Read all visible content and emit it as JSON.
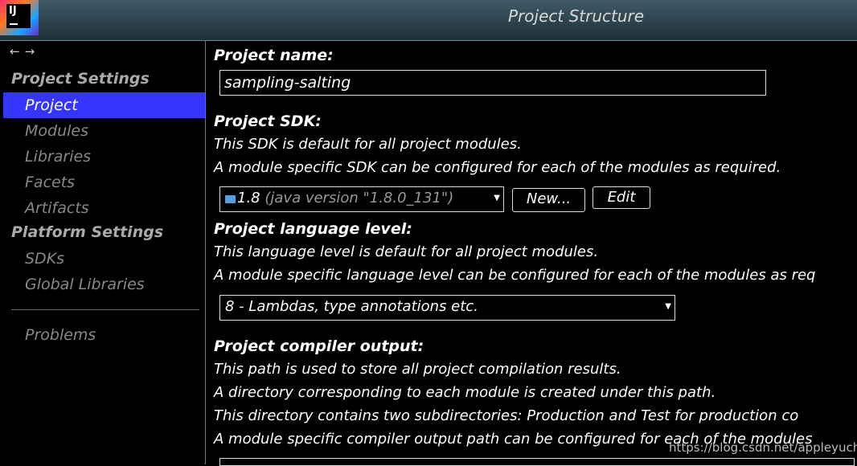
{
  "window": {
    "title": "Project Structure",
    "app_icon_text": "IJ"
  },
  "nav": {
    "back": "←",
    "forward": "→"
  },
  "sidebar": {
    "project_settings_header": "Project Settings",
    "project_settings_items": [
      {
        "label": "Project",
        "selected": true
      },
      {
        "label": "Modules"
      },
      {
        "label": "Libraries"
      },
      {
        "label": "Facets"
      },
      {
        "label": "Artifacts"
      }
    ],
    "platform_settings_header": "Platform Settings",
    "platform_settings_items": [
      {
        "label": "SDKs"
      },
      {
        "label": "Global Libraries"
      }
    ],
    "problems_label": "Problems"
  },
  "project_name": {
    "label": "Project name:",
    "value": "sampling-salting"
  },
  "project_sdk": {
    "label": "Project SDK:",
    "desc1": "This SDK is default for all project modules.",
    "desc2": "A module specific SDK can be configured for each of the modules as required.",
    "selected_version": "1.8",
    "selected_detail": "(java version \"1.8.0_131\")",
    "new_button": "New...",
    "edit_button": "Edit"
  },
  "language_level": {
    "label": "Project language level:",
    "desc1": "This language level is default for all project modules.",
    "desc2": "A module specific language level can be configured for each of the modules as req",
    "selected": "8 - Lambdas, type annotations etc."
  },
  "compiler_output": {
    "label": "Project compiler output:",
    "desc1": "This path is used to store all project compilation results.",
    "desc2": "A directory corresponding to each module is created under this path.",
    "desc3": "This directory contains two subdirectories: Production and Test for production co",
    "desc4": "A module specific compiler output path can be configured for each of the modules"
  },
  "watermark": "https://blog.csdn.net/appleyuchi",
  "colors": {
    "selection": "#3535ff",
    "background": "#000000",
    "titlebar": "#2c4550"
  }
}
